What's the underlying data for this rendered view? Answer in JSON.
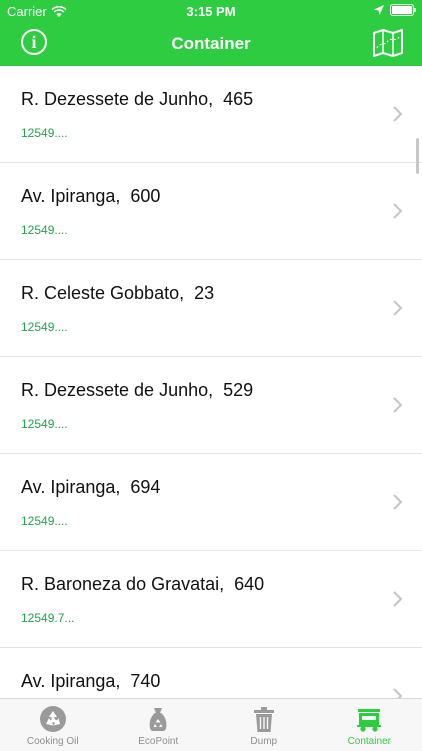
{
  "status_bar": {
    "carrier": "Carrier",
    "time": "3:15 PM"
  },
  "nav": {
    "title": "Container",
    "info_label": "i"
  },
  "items": [
    {
      "address": "R. Dezessete de Junho,  465",
      "zip": "12549...."
    },
    {
      "address": "Av. Ipiranga,  600",
      "zip": "12549...."
    },
    {
      "address": "R. Celeste Gobbato,  23",
      "zip": "12549...."
    },
    {
      "address": "R. Dezessete de Junho,  529",
      "zip": "12549...."
    },
    {
      "address": "Av. Ipiranga,  694",
      "zip": "12549...."
    },
    {
      "address": "R. Baroneza do Gravatai,  640",
      "zip": "12549.7..."
    },
    {
      "address": "Av. Ipiranga,  740",
      "zip": ""
    }
  ],
  "tabs": [
    {
      "label": "Cooking Oil",
      "icon": "recycle-icon"
    },
    {
      "label": "EcoPoint",
      "icon": "recycle-bag-icon"
    },
    {
      "label": "Dump",
      "icon": "trash-icon"
    },
    {
      "label": "Container",
      "icon": "container-truck-icon"
    }
  ],
  "active_tab": "Container",
  "colors": {
    "accent": "#2ecc40",
    "zip_text": "#20a34a",
    "inactive": "#8e8e8e"
  }
}
